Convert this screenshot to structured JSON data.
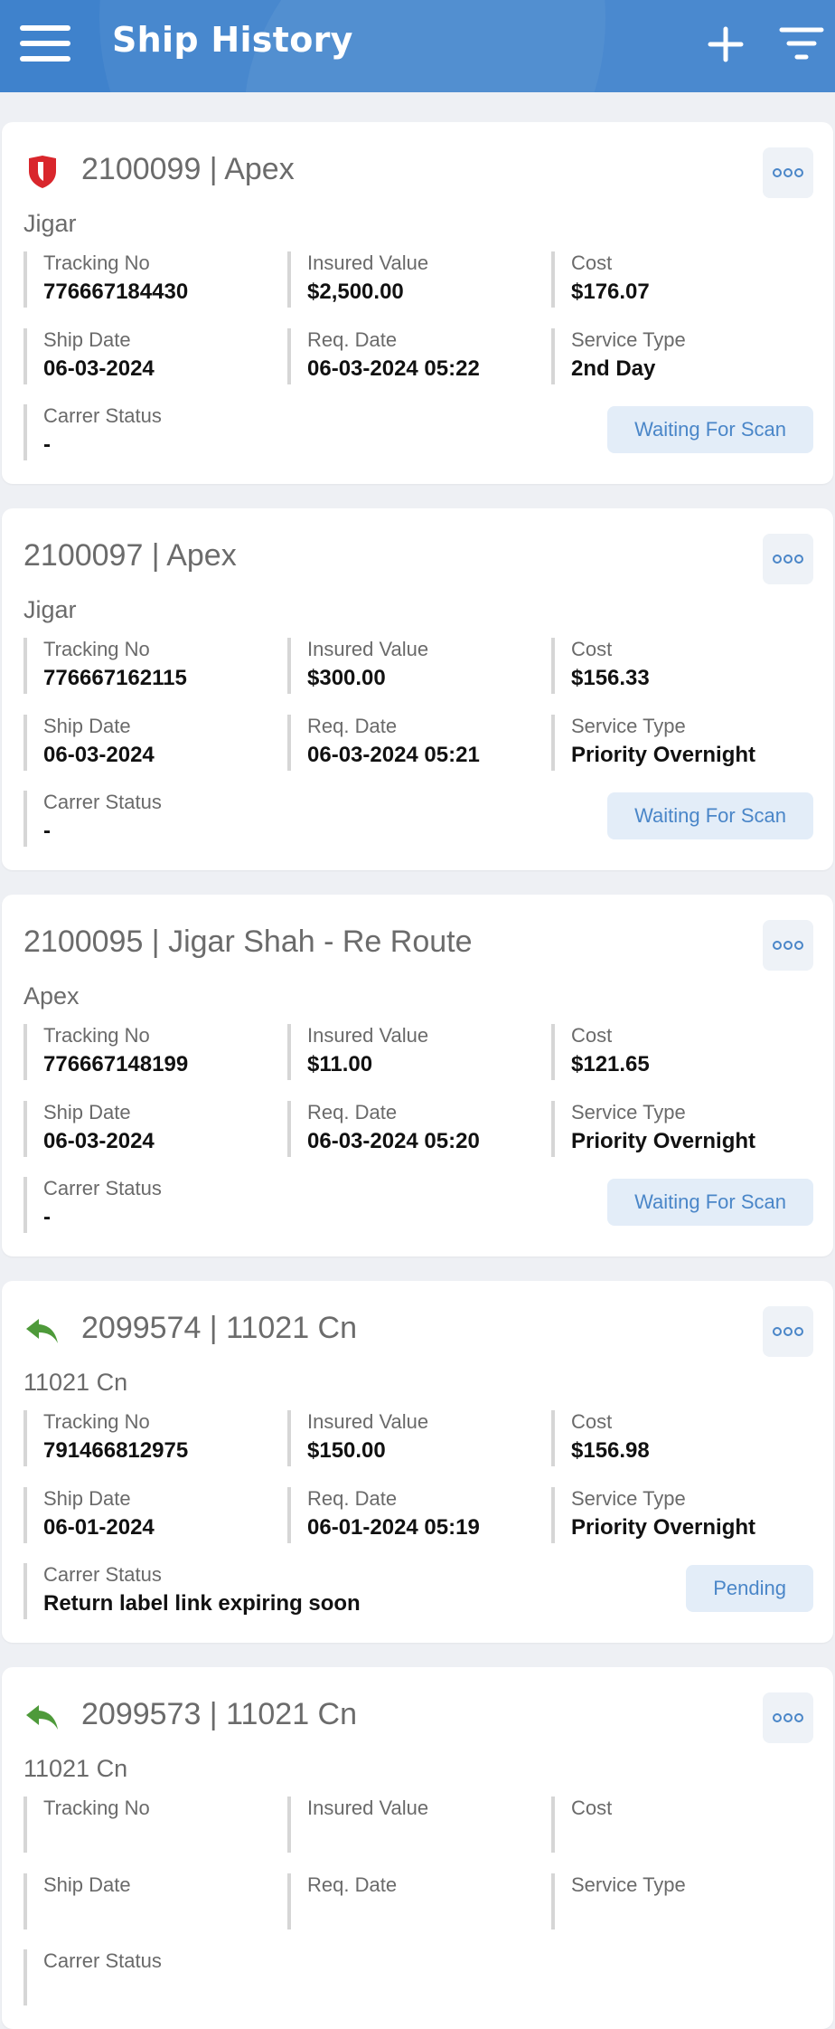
{
  "header": {
    "title": "Ship History",
    "menu_icon": "hamburger-menu-icon",
    "add_icon": "plus-icon",
    "filter_icon": "filter-icon",
    "background_color": "#3f82cc"
  },
  "labels": {
    "tracking": "Tracking No",
    "insured": "Insured Value",
    "cost": "Cost",
    "ship_date": "Ship Date",
    "req_date": "Req. Date",
    "service": "Service Type",
    "carrier": "Carrer Status"
  },
  "shipments": [
    {
      "icon": "red-shield-icon",
      "title": "2100099 | Apex",
      "subtitle": "Jigar",
      "tracking_no": "776667184430",
      "insured_value": "$2,500.00",
      "cost": "$176.07",
      "ship_date": "06-03-2024",
      "req_date": "06-03-2024 05:22",
      "service_type": "2nd Day",
      "carrier_status": "-",
      "status": "Waiting For Scan"
    },
    {
      "icon": "",
      "title": "2100097 | Apex",
      "subtitle": "Jigar",
      "tracking_no": "776667162115",
      "insured_value": "$300.00",
      "cost": "$156.33",
      "ship_date": "06-03-2024",
      "req_date": "06-03-2024 05:21",
      "service_type": "Priority Overnight",
      "carrier_status": "-",
      "status": "Waiting For Scan"
    },
    {
      "icon": "",
      "title": "2100095 | Jigar Shah - Re Route",
      "subtitle": "Apex",
      "tracking_no": "776667148199",
      "insured_value": "$11.00",
      "cost": "$121.65",
      "ship_date": "06-03-2024",
      "req_date": "06-03-2024 05:20",
      "service_type": "Priority Overnight",
      "carrier_status": "-",
      "status": "Waiting For Scan"
    },
    {
      "icon": "green-return-arrow-icon",
      "title": "2099574 | 11021 Cn",
      "subtitle": "11021 Cn",
      "tracking_no": "791466812975",
      "insured_value": "$150.00",
      "cost": "$156.98",
      "ship_date": "06-01-2024",
      "req_date": "06-01-2024 05:19",
      "service_type": "Priority Overnight",
      "carrier_status": "Return label link expiring soon",
      "status": "Pending"
    },
    {
      "icon": "green-return-arrow-icon",
      "title": "2099573 | 11021 Cn",
      "subtitle": "11021 Cn",
      "tracking_no": "",
      "insured_value": "",
      "cost": "",
      "ship_date": "",
      "req_date": "",
      "service_type": "",
      "carrier_status": "",
      "status": ""
    }
  ],
  "colors": {
    "accent": "#4a86c8",
    "status_bg": "#e3edf8",
    "shield_red": "#d9262c",
    "return_green": "#4e9a3a"
  }
}
